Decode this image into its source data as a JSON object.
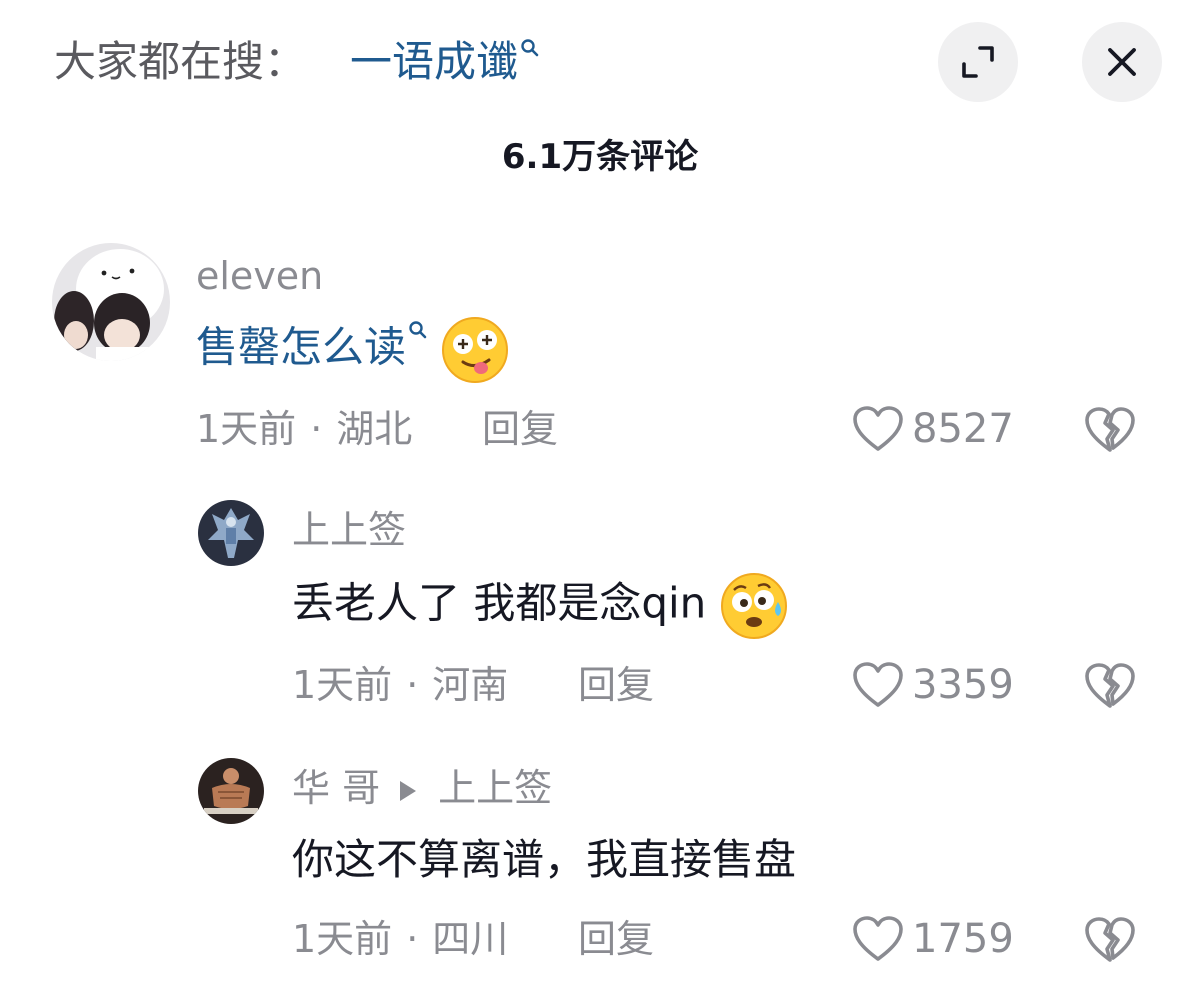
{
  "header": {
    "search_prefix": "大家都在搜：",
    "search_term": "一语成谶",
    "expand_icon": "expand-icon",
    "close_icon": "close-icon"
  },
  "comment_count": "6.1万条评论",
  "comments": [
    {
      "username": "eleven",
      "text": "售罄怎么读",
      "text_link_color": "#1f5a8f",
      "emoji": "dizzy-tongue-face",
      "time": "1天前",
      "location": "湖北",
      "reply_label": "回复",
      "likes": "8527",
      "replies": [
        {
          "username": "上上签",
          "text": "丢老人了 我都是念qin",
          "emoji": "anxious-sweat-face",
          "time": "1天前",
          "location": "河南",
          "reply_label": "回复",
          "likes": "3359"
        },
        {
          "username": "华 哥",
          "reply_to": "上上签",
          "text": "你这不算离谱，我直接售盘",
          "time": "1天前",
          "location": "四川",
          "reply_label": "回复",
          "likes": "1759"
        }
      ]
    }
  ],
  "colors": {
    "link": "#1f5a8f",
    "muted": "#8a8b91",
    "text": "#161823",
    "button_bg": "#f0f0f1"
  }
}
